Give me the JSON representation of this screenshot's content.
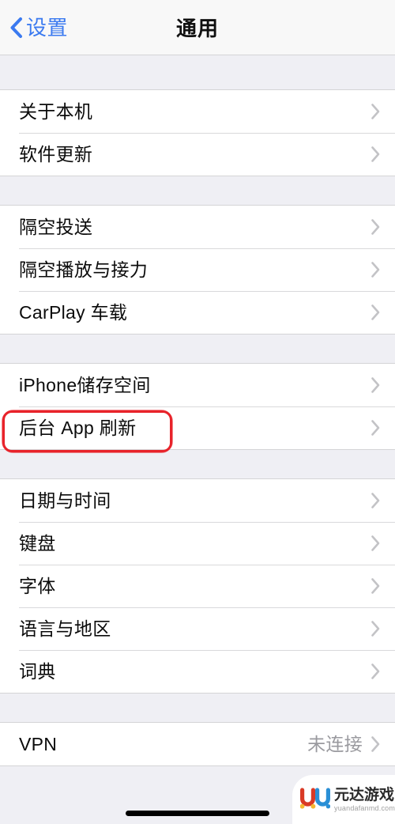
{
  "navbar": {
    "back_label": "设置",
    "back_icon": "chevron-left-icon",
    "title": "通用",
    "accent_color": "#3b7af0"
  },
  "groups": [
    {
      "id": "device-info",
      "rows": [
        {
          "label": "关于本机",
          "value": "",
          "accessory": "chevron-right-icon"
        },
        {
          "label": "软件更新",
          "value": "",
          "accessory": "chevron-right-icon"
        }
      ]
    },
    {
      "id": "connectivity",
      "rows": [
        {
          "label": "隔空投送",
          "value": "",
          "accessory": "chevron-right-icon"
        },
        {
          "label": "隔空播放与接力",
          "value": "",
          "accessory": "chevron-right-icon"
        },
        {
          "label": "CarPlay 车载",
          "value": "",
          "accessory": "chevron-right-icon"
        }
      ]
    },
    {
      "id": "storage-and-refresh",
      "rows": [
        {
          "label": "iPhone储存空间",
          "value": "",
          "accessory": "chevron-right-icon"
        },
        {
          "label": "后台 App 刷新",
          "value": "",
          "accessory": "chevron-right-icon",
          "highlighted": true
        }
      ]
    },
    {
      "id": "localization",
      "rows": [
        {
          "label": "日期与时间",
          "value": "",
          "accessory": "chevron-right-icon"
        },
        {
          "label": "键盘",
          "value": "",
          "accessory": "chevron-right-icon"
        },
        {
          "label": "字体",
          "value": "",
          "accessory": "chevron-right-icon"
        },
        {
          "label": "语言与地区",
          "value": "",
          "accessory": "chevron-right-icon"
        },
        {
          "label": "词典",
          "value": "",
          "accessory": "chevron-right-icon"
        }
      ]
    },
    {
      "id": "network",
      "rows": [
        {
          "label": "VPN",
          "value": "未连接",
          "accessory": "chevron-right-icon"
        }
      ]
    }
  ],
  "annotation": {
    "target_label": "后台 App 刷新",
    "color": "#e8232a",
    "shape": "rounded-rectangle"
  },
  "watermark": {
    "title": "元达游戏",
    "url": "yuandafanmd.com",
    "logo_colors": {
      "left": "#d93a26",
      "right": "#2a8fd6",
      "dot_yellow": "#f5b731"
    }
  },
  "system": {
    "home_indicator": true,
    "background_color": "#efeff4",
    "row_background_color": "#ffffff"
  }
}
